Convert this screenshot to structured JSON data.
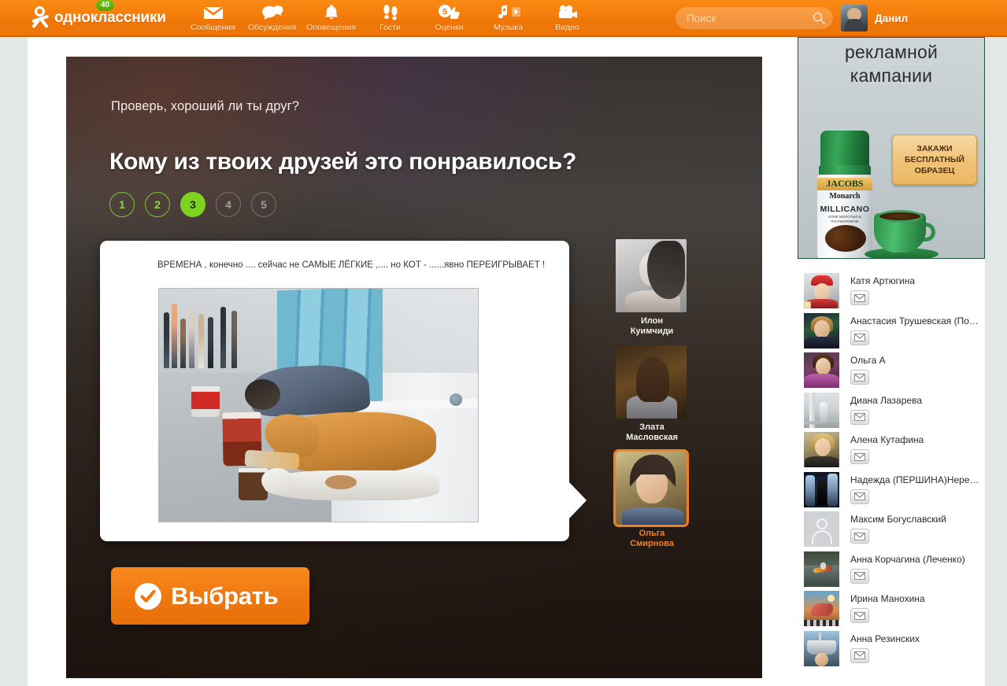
{
  "header": {
    "logo_text": "одноклассники",
    "logo_badge": "40",
    "nav": [
      {
        "label": "Сообщения",
        "icon": "envelope-icon"
      },
      {
        "label": "Обсуждения",
        "icon": "chat-bubbles-icon"
      },
      {
        "label": "Оповещения",
        "icon": "bell-icon"
      },
      {
        "label": "Гости",
        "icon": "footprints-icon"
      },
      {
        "label": "Оценки",
        "icon": "thumbs-up-icon",
        "badge": "5"
      },
      {
        "label": "Музыка",
        "icon": "music-note-icon"
      },
      {
        "label": "Видео",
        "icon": "video-camera-icon"
      }
    ],
    "search": {
      "placeholder": "Поиск",
      "value": "",
      "icon": "search-icon"
    },
    "user": {
      "name": "Данил",
      "avatar": "user-avatar"
    }
  },
  "stage": {
    "kicker": "Проверь, хороший ли ты друг?",
    "headline": "Кому из твоих друзей это понравилось?",
    "steps": [
      {
        "label": "1",
        "state": "done"
      },
      {
        "label": "2",
        "state": "done"
      },
      {
        "label": "3",
        "state": "current"
      },
      {
        "label": "4",
        "state": "pending"
      },
      {
        "label": "5",
        "state": "pending"
      }
    ],
    "card": {
      "text": "ВРЕМЕНА , конечно .... сейчас не САМЫЕ ЛЁГКИЕ ,.... но КОТ - ......явно ПЕРЕИГРЫВАЕТ !",
      "photo_alt": "Бездомный человек с собакой и кошкой на пешеходном переходе"
    },
    "candidates": [
      {
        "name": "Илон\nКуимчиди",
        "first": "Илон",
        "last": "Куимчиди",
        "selected": false
      },
      {
        "name": "Злата\nМасловская",
        "first": "Злата",
        "last": "Масловская",
        "selected": false
      },
      {
        "name": "Ольга\nСмирнова",
        "first": "Ольга",
        "last": "Смирнова",
        "selected": true
      }
    ],
    "submit_button": {
      "label": "Выбрать",
      "icon": "check-circle-icon",
      "color": "#f17c1a"
    }
  },
  "ad": {
    "title_line1": "рекламной",
    "title_line2": "кампании",
    "cta_line1": "ЗАКАЖИ",
    "cta_line2": "БЕСПЛАТНЫЙ",
    "cta_line3": "ОБРАЗЕЦ",
    "product_brand": "JACOBS",
    "product_sub": "Monarch",
    "product_name": "MILLICANO",
    "product_tagline": "КОФЕ МОЛОТЫЙ В РАСТВОРИМОМ"
  },
  "friends": {
    "message_icon": "envelope-icon",
    "items": [
      {
        "name": "Катя Артюгина",
        "avatar": "av-a",
        "online": true
      },
      {
        "name": "Анастасия Трушевская (По…",
        "avatar": "av-b",
        "online": false
      },
      {
        "name": "Ольга А",
        "avatar": "av-c",
        "online": false
      },
      {
        "name": "Диана Лазарева",
        "avatar": "av-d",
        "online": false
      },
      {
        "name": "Алена Кутафина",
        "avatar": "av-e",
        "online": false
      },
      {
        "name": "Надежда (ПЕРШИНА)Нере…",
        "avatar": "av-f",
        "online": false
      },
      {
        "name": "Максим Богуславский",
        "avatar": "av-g",
        "online": false
      },
      {
        "name": "Анна Корчагина (Леченко)",
        "avatar": "av-h",
        "online": false
      },
      {
        "name": "Ирина Манохина",
        "avatar": "av-i",
        "online": false
      },
      {
        "name": "Анна Резинских",
        "avatar": "av-j",
        "online": false
      }
    ]
  },
  "colors": {
    "brand_orange": "#f17c1a",
    "accent_green": "#7ed321",
    "selected_outline": "#f08020"
  }
}
